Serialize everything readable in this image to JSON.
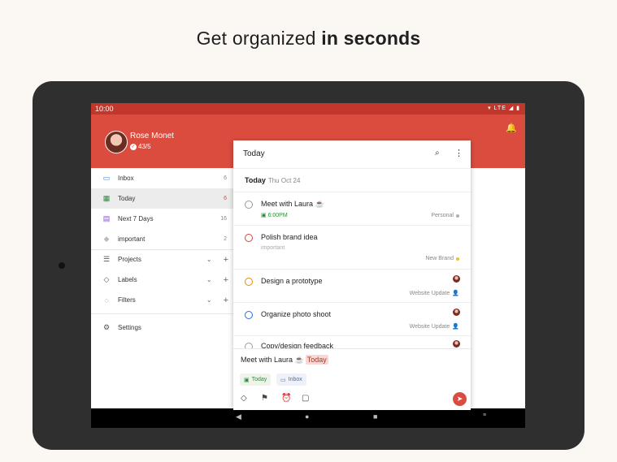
{
  "headline": {
    "normal": "Get organized ",
    "bold": "in seconds"
  },
  "status_bar": {
    "time": "10:00",
    "icons": "▾ LTE ◢ ▮"
  },
  "user": {
    "name": "Rose Monet",
    "karma": "43/5"
  },
  "sidebar": {
    "items": [
      {
        "label": "Inbox",
        "icon": "inbox-icon",
        "glyph": "▭",
        "count": "6"
      },
      {
        "label": "Today",
        "icon": "calendar-today-icon",
        "glyph": "▦",
        "count": "6"
      },
      {
        "label": "Next 7 Days",
        "icon": "calendar-week-icon",
        "glyph": "▤",
        "count": "16"
      },
      {
        "label": "important",
        "icon": "tag-icon",
        "glyph": "◆",
        "count": "2"
      },
      {
        "label": "Projects",
        "icon": "list-icon",
        "glyph": "☰"
      },
      {
        "label": "Labels",
        "icon": "label-icon",
        "glyph": "◇"
      },
      {
        "label": "Filters",
        "icon": "filter-drop-icon",
        "glyph": "◌"
      },
      {
        "label": "Settings",
        "icon": "gear-icon",
        "glyph": "⚙"
      }
    ]
  },
  "panel": {
    "title": "Today",
    "section_title": "Today",
    "section_date": "Thu Oct 24",
    "tasks": [
      {
        "title": "Meet with Laura ☕",
        "time": "6:00PM",
        "project": "Personal",
        "project_color": "#b0b0b0"
      },
      {
        "title": "Polish brand idea",
        "label": "important",
        "project": "New Brand",
        "project_color": "#f2c21b"
      },
      {
        "title": "Design a prototype",
        "project": "Website Update",
        "project_color": "#4a90e2"
      },
      {
        "title": "Organize photo shoot",
        "project": "Website Update",
        "project_color": "#4a90e2"
      },
      {
        "title": "Copy/design feedback"
      }
    ]
  },
  "quick_add": {
    "text": "Meet with Laura ☕",
    "date_token": "Today",
    "chip_today": "Today",
    "chip_inbox": "Inbox"
  },
  "colors": {
    "brand": "#db4c3f",
    "priority1": "#d1453b",
    "priority2": "#eb8909",
    "priority3": "#246fe0"
  }
}
